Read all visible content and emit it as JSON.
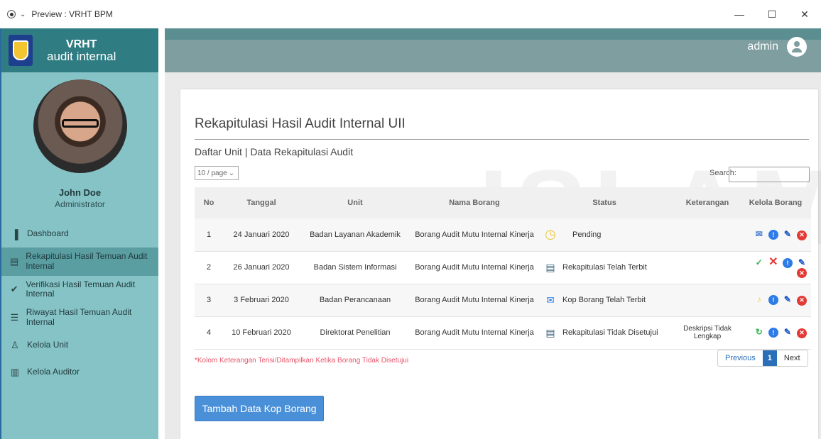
{
  "window": {
    "title": "Preview : VRHT BPM",
    "minimize": "—",
    "maximize": "☐",
    "close": "✕"
  },
  "brand": {
    "line1": "VRHT",
    "line2": "audit internal"
  },
  "header": {
    "user": "admin"
  },
  "profile": {
    "name": "John Doe",
    "role": "Administrator"
  },
  "sidebar": {
    "items": [
      {
        "icon": "bar-chart-icon",
        "glyph": "▐",
        "label": "Dashboard"
      },
      {
        "icon": "document-icon",
        "glyph": "▤",
        "label": "Rekapitulasi Hasil Temuan Audit Internal"
      },
      {
        "icon": "check-circle-icon",
        "glyph": "✔",
        "label": "Verifikasi Hasil Temuan Audit Internal"
      },
      {
        "icon": "list-icon",
        "glyph": "☰",
        "label": "Riwayat Hasil Temuan Audit Internal"
      },
      {
        "icon": "user-icon",
        "glyph": "♙",
        "label": "Kelola Unit"
      },
      {
        "icon": "barcode-icon",
        "glyph": "▥",
        "label": "Kelola Auditor"
      }
    ]
  },
  "main": {
    "title": "Rekapitulasi Hasil Audit Internal UII",
    "subtitle": "Daftar Unit | Data Rekapitulasi Audit",
    "page_size": "10 / page",
    "search_label": "Search:",
    "watermark": "ISLAM",
    "table": {
      "headers": [
        "No",
        "Tanggal",
        "Unit",
        "Nama Borang",
        "Status",
        "Keterangan",
        "Kelola Borang"
      ],
      "rows": [
        {
          "no": "1",
          "tanggal": "24 Januari 2020",
          "unit": "Badan Layanan Akademik",
          "nama": "Borang Audit Mutu Internal Kinerja",
          "status": "Pending",
          "status_icon": "clock-icon",
          "keterangan": "",
          "actions": [
            "mail-icon",
            "info-icon",
            "edit-icon",
            "delete-icon"
          ]
        },
        {
          "no": "2",
          "tanggal": "26 Januari 2020",
          "unit": "Badan Sistem Informasi",
          "nama": "Borang Audit Mutu Internal Kinerja",
          "status": "Rekapitulasi Telah Terbit",
          "status_icon": "doc-check-icon",
          "keterangan": "",
          "actions": [
            "check-icon",
            "x-icon",
            "info-icon",
            "edit-icon",
            "delete-icon"
          ]
        },
        {
          "no": "3",
          "tanggal": "3 Februari 2020",
          "unit": "Badan Perancanaan",
          "nama": "Borang Audit Mutu Internal Kinerja",
          "status": "Kop Borang Telah Terbit",
          "status_icon": "envelope-icon",
          "keterangan": "",
          "actions": [
            "bell-icon",
            "info-icon",
            "edit-icon",
            "delete-icon"
          ]
        },
        {
          "no": "4",
          "tanggal": "10 Februari 2020",
          "unit": "Direktorat Penelitian",
          "nama": "Borang Audit Mutu Internal Kinerja",
          "status": "Rekapitulasi Tidak Disetujui",
          "status_icon": "doc-x-icon",
          "keterangan": "Deskripsi Tidak Lengkap",
          "actions": [
            "refresh-icon",
            "info-icon",
            "edit-icon",
            "delete-icon"
          ]
        }
      ]
    },
    "note": "*Kolom Keterangan Terisi/Ditampilkan Ketika Borang Tidak Disetujui",
    "pagination": {
      "previous": "Previous",
      "current": "1",
      "next": "Next"
    },
    "add_button": "Tambah Data Kop Borang"
  },
  "colors": {
    "sidebar": "#86c3c6",
    "sidebar_head": "#2f7d82",
    "header": "#7e9ea0",
    "primary": "#4a90d9",
    "note": "#e8556a"
  }
}
